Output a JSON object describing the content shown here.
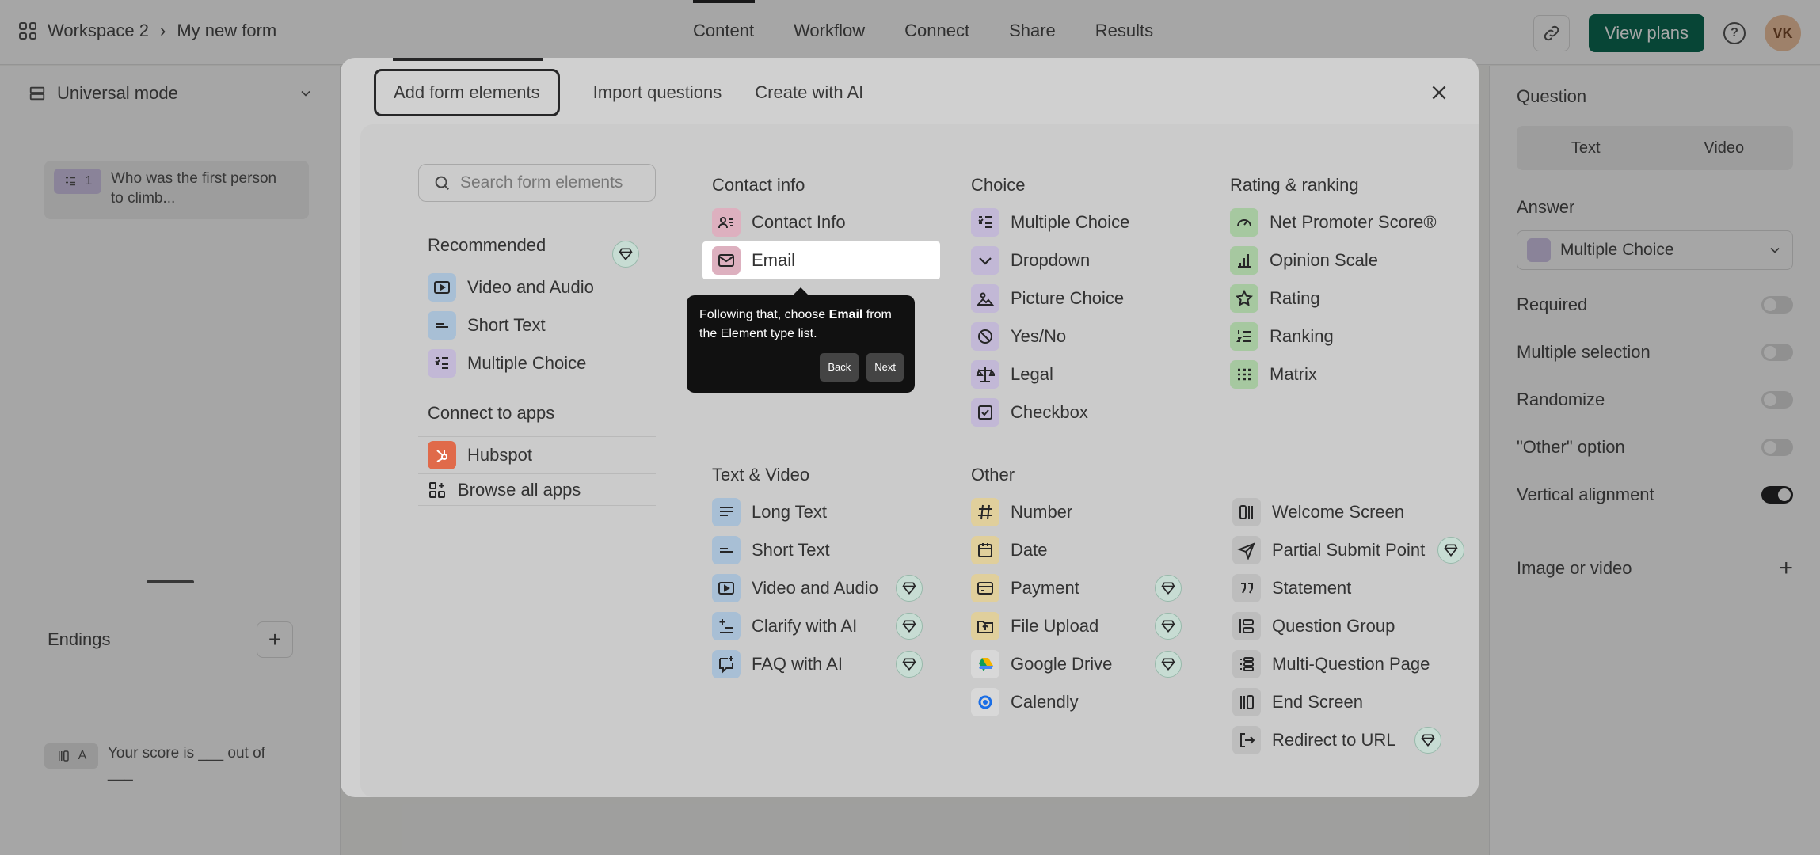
{
  "header": {
    "workspace": "Workspace 2",
    "separator": "›",
    "form_name": "My new form",
    "tabs": [
      "Content",
      "Workflow",
      "Connect",
      "Share",
      "Results"
    ],
    "view_plans": "View plans",
    "help": "?",
    "avatar": "VK"
  },
  "left_panel": {
    "mode": "Universal mode",
    "question": {
      "number": "1",
      "text": "Who was the first person to climb..."
    },
    "endings_label": "Endings",
    "ending": {
      "letter": "A",
      "text": "Your score is ___ out of ___"
    }
  },
  "right_panel": {
    "question_label": "Question",
    "seg_text": "Text",
    "seg_video": "Video",
    "answer_label": "Answer",
    "answer_type": "Multiple Choice",
    "settings": [
      {
        "label": "Required",
        "on": false
      },
      {
        "label": "Multiple selection",
        "on": false
      },
      {
        "label": "Randomize",
        "on": false
      },
      {
        "label": "\"Other\" option",
        "on": false
      },
      {
        "label": "Vertical alignment",
        "on": true
      }
    ],
    "image_label": "Image or video"
  },
  "modal": {
    "tabs": [
      "Add form elements",
      "Import questions",
      "Create with AI"
    ],
    "search_placeholder": "Search form elements",
    "recommended_label": "Recommended",
    "recommended": [
      "Video and Audio",
      "Short Text",
      "Multiple Choice"
    ],
    "apps_label": "Connect to apps",
    "apps": [
      "Hubspot",
      "Browse all apps"
    ],
    "contact_label": "Contact info",
    "contact": [
      "Contact Info",
      "Email"
    ],
    "choice_label": "Choice",
    "choice": [
      "Multiple Choice",
      "Dropdown",
      "Picture Choice",
      "Yes/No",
      "Legal",
      "Checkbox"
    ],
    "rating_label": "Rating & ranking",
    "rating": [
      "Net Promoter Score®",
      "Opinion Scale",
      "Rating",
      "Ranking",
      "Matrix"
    ],
    "textvideo_label": "Text & Video",
    "textvideo": [
      "Long Text",
      "Short Text",
      "Video and Audio",
      "Clarify with AI",
      "FAQ with AI"
    ],
    "other_label": "Other",
    "other": [
      "Number",
      "Date",
      "Payment",
      "File Upload",
      "Google Drive",
      "Calendly"
    ],
    "misc": [
      "Welcome Screen",
      "Partial Submit Point",
      "Statement",
      "Question Group",
      "Multi-Question Page",
      "End Screen",
      "Redirect to URL"
    ]
  },
  "tooltip": {
    "prefix": "Following that, choose ",
    "bold": "Email",
    "suffix": " from the Element type list.",
    "back": "Back",
    "next": "Next"
  },
  "colors": {
    "blue_icon": "#a8bfd5",
    "purple_icon": "#c2b8d6",
    "green_icon": "#a6c8a0",
    "pink_icon": "#ddb0bf",
    "yellow_icon": "#e0cf9c",
    "gray_icon": "#bdbdbd",
    "hubspot": "#e06a4a",
    "brand_green": "#0b6b54"
  }
}
